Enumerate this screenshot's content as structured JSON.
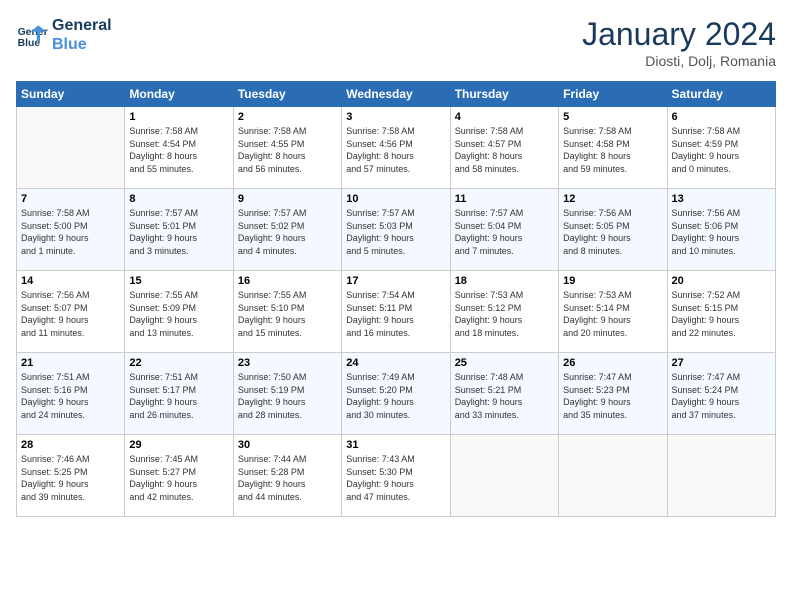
{
  "header": {
    "logo_line1": "General",
    "logo_line2": "Blue",
    "month": "January 2024",
    "location": "Diosti, Dolj, Romania"
  },
  "weekdays": [
    "Sunday",
    "Monday",
    "Tuesday",
    "Wednesday",
    "Thursday",
    "Friday",
    "Saturday"
  ],
  "weeks": [
    [
      {
        "day": "",
        "info": ""
      },
      {
        "day": "1",
        "info": "Sunrise: 7:58 AM\nSunset: 4:54 PM\nDaylight: 8 hours\nand 55 minutes."
      },
      {
        "day": "2",
        "info": "Sunrise: 7:58 AM\nSunset: 4:55 PM\nDaylight: 8 hours\nand 56 minutes."
      },
      {
        "day": "3",
        "info": "Sunrise: 7:58 AM\nSunset: 4:56 PM\nDaylight: 8 hours\nand 57 minutes."
      },
      {
        "day": "4",
        "info": "Sunrise: 7:58 AM\nSunset: 4:57 PM\nDaylight: 8 hours\nand 58 minutes."
      },
      {
        "day": "5",
        "info": "Sunrise: 7:58 AM\nSunset: 4:58 PM\nDaylight: 8 hours\nand 59 minutes."
      },
      {
        "day": "6",
        "info": "Sunrise: 7:58 AM\nSunset: 4:59 PM\nDaylight: 9 hours\nand 0 minutes."
      }
    ],
    [
      {
        "day": "7",
        "info": "Sunrise: 7:58 AM\nSunset: 5:00 PM\nDaylight: 9 hours\nand 1 minute."
      },
      {
        "day": "8",
        "info": "Sunrise: 7:57 AM\nSunset: 5:01 PM\nDaylight: 9 hours\nand 3 minutes."
      },
      {
        "day": "9",
        "info": "Sunrise: 7:57 AM\nSunset: 5:02 PM\nDaylight: 9 hours\nand 4 minutes."
      },
      {
        "day": "10",
        "info": "Sunrise: 7:57 AM\nSunset: 5:03 PM\nDaylight: 9 hours\nand 5 minutes."
      },
      {
        "day": "11",
        "info": "Sunrise: 7:57 AM\nSunset: 5:04 PM\nDaylight: 9 hours\nand 7 minutes."
      },
      {
        "day": "12",
        "info": "Sunrise: 7:56 AM\nSunset: 5:05 PM\nDaylight: 9 hours\nand 8 minutes."
      },
      {
        "day": "13",
        "info": "Sunrise: 7:56 AM\nSunset: 5:06 PM\nDaylight: 9 hours\nand 10 minutes."
      }
    ],
    [
      {
        "day": "14",
        "info": "Sunrise: 7:56 AM\nSunset: 5:07 PM\nDaylight: 9 hours\nand 11 minutes."
      },
      {
        "day": "15",
        "info": "Sunrise: 7:55 AM\nSunset: 5:09 PM\nDaylight: 9 hours\nand 13 minutes."
      },
      {
        "day": "16",
        "info": "Sunrise: 7:55 AM\nSunset: 5:10 PM\nDaylight: 9 hours\nand 15 minutes."
      },
      {
        "day": "17",
        "info": "Sunrise: 7:54 AM\nSunset: 5:11 PM\nDaylight: 9 hours\nand 16 minutes."
      },
      {
        "day": "18",
        "info": "Sunrise: 7:53 AM\nSunset: 5:12 PM\nDaylight: 9 hours\nand 18 minutes."
      },
      {
        "day": "19",
        "info": "Sunrise: 7:53 AM\nSunset: 5:14 PM\nDaylight: 9 hours\nand 20 minutes."
      },
      {
        "day": "20",
        "info": "Sunrise: 7:52 AM\nSunset: 5:15 PM\nDaylight: 9 hours\nand 22 minutes."
      }
    ],
    [
      {
        "day": "21",
        "info": "Sunrise: 7:51 AM\nSunset: 5:16 PM\nDaylight: 9 hours\nand 24 minutes."
      },
      {
        "day": "22",
        "info": "Sunrise: 7:51 AM\nSunset: 5:17 PM\nDaylight: 9 hours\nand 26 minutes."
      },
      {
        "day": "23",
        "info": "Sunrise: 7:50 AM\nSunset: 5:19 PM\nDaylight: 9 hours\nand 28 minutes."
      },
      {
        "day": "24",
        "info": "Sunrise: 7:49 AM\nSunset: 5:20 PM\nDaylight: 9 hours\nand 30 minutes."
      },
      {
        "day": "25",
        "info": "Sunrise: 7:48 AM\nSunset: 5:21 PM\nDaylight: 9 hours\nand 33 minutes."
      },
      {
        "day": "26",
        "info": "Sunrise: 7:47 AM\nSunset: 5:23 PM\nDaylight: 9 hours\nand 35 minutes."
      },
      {
        "day": "27",
        "info": "Sunrise: 7:47 AM\nSunset: 5:24 PM\nDaylight: 9 hours\nand 37 minutes."
      }
    ],
    [
      {
        "day": "28",
        "info": "Sunrise: 7:46 AM\nSunset: 5:25 PM\nDaylight: 9 hours\nand 39 minutes."
      },
      {
        "day": "29",
        "info": "Sunrise: 7:45 AM\nSunset: 5:27 PM\nDaylight: 9 hours\nand 42 minutes."
      },
      {
        "day": "30",
        "info": "Sunrise: 7:44 AM\nSunset: 5:28 PM\nDaylight: 9 hours\nand 44 minutes."
      },
      {
        "day": "31",
        "info": "Sunrise: 7:43 AM\nSunset: 5:30 PM\nDaylight: 9 hours\nand 47 minutes."
      },
      {
        "day": "",
        "info": ""
      },
      {
        "day": "",
        "info": ""
      },
      {
        "day": "",
        "info": ""
      }
    ]
  ]
}
